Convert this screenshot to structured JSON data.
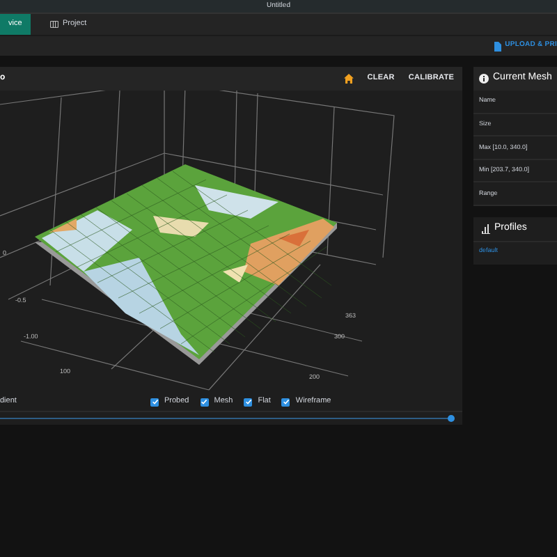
{
  "window": {
    "title": "Untitled"
  },
  "tabs": [
    {
      "label": "vice",
      "selected": true,
      "kind": "plain"
    },
    {
      "label": "Project",
      "selected": false,
      "kind": "icon"
    }
  ],
  "toolbar": {
    "action": "UPLOAD & PRI"
  },
  "plot_card": {
    "title": "o",
    "actions": [
      "CLEAR",
      "CALIBRATE"
    ],
    "axis_labels": [
      "0",
      "-0.5",
      "-1.00",
      "100",
      "363",
      "300",
      "200"
    ],
    "legend_label": "dient",
    "toggles": [
      {
        "label": "Probed",
        "checked": true
      },
      {
        "label": "Mesh",
        "checked": true
      },
      {
        "label": "Flat",
        "checked": true
      },
      {
        "label": "Wireframe",
        "checked": true
      }
    ],
    "slider": {
      "level": 1
    }
  },
  "mesh_card": {
    "title": "Current Mesh",
    "rows": [
      "Name",
      "Size",
      "Max [10.0, 340.0]",
      "Min [203.7, 340.0]",
      "Range"
    ]
  },
  "profiles_card": {
    "title": "Profiles",
    "items": [
      "default"
    ]
  }
}
